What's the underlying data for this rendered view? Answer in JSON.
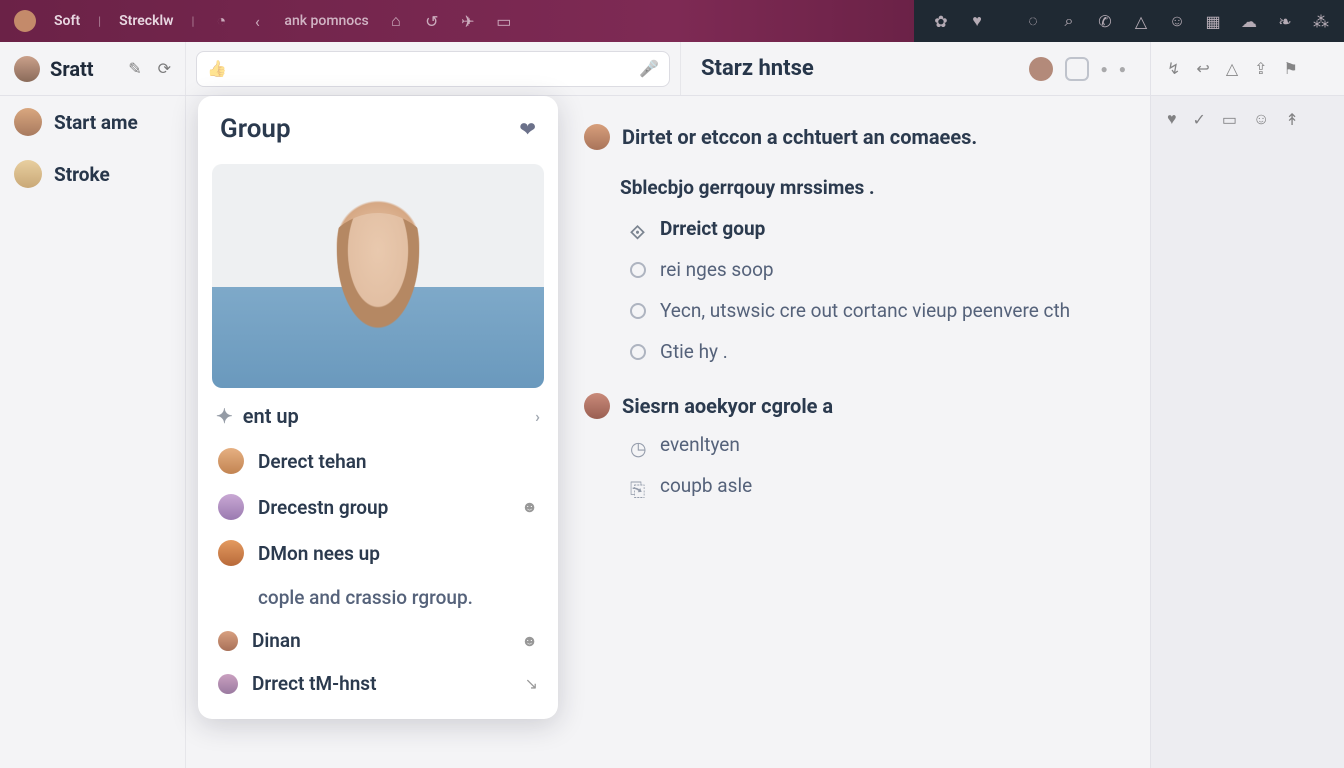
{
  "titlebar": {
    "app": "Soft",
    "workspace": "Strecklw",
    "crumb": "ank pomnocs"
  },
  "sidebar": {
    "current_user": "Sratt",
    "conversations": [
      {
        "name": "Start ame"
      },
      {
        "name": "Stroke"
      }
    ]
  },
  "search": {
    "placeholder": ""
  },
  "secondary": {
    "title": "Starz hntse"
  },
  "card": {
    "title": "Group",
    "section": "ent up",
    "people": [
      {
        "name": "Derect tehan"
      },
      {
        "name": "Drecestn group"
      },
      {
        "name": "DMon nees up"
      },
      {
        "name": "cople and crassio rgroup.",
        "muted": true,
        "noav": true
      },
      {
        "name": "Dinan"
      },
      {
        "name": "Drrect tM-hnst"
      }
    ]
  },
  "main": {
    "heading": "Dirtet or etccon a cchtuert an comaees.",
    "subheading": "Sblecbjo gerrqouy mrssimes .",
    "options": [
      {
        "label": "Drreict goup",
        "primary": true
      },
      {
        "label": "rei nges soop"
      },
      {
        "label": "Yecn, utswsic cre out cortanc vieup peenvere cth"
      },
      {
        "label": "Gtie hy ."
      }
    ],
    "second_user": "Siesrn aoekyor cgrole a",
    "second_opts": [
      {
        "label": "evenltyen"
      },
      {
        "label": "coupb asle"
      }
    ]
  }
}
